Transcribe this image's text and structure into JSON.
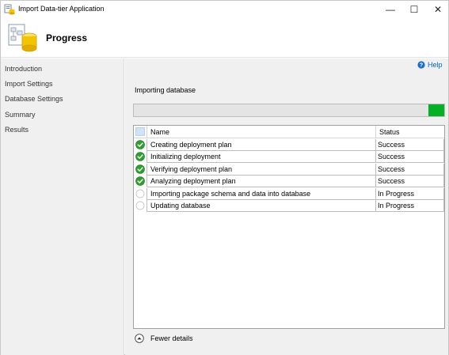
{
  "window": {
    "title": "Import Data-tier Application",
    "minimize_glyph": "—",
    "maximize_glyph": "☐",
    "close_glyph": "✕"
  },
  "header": {
    "title": "Progress",
    "icon": "database-wizard-icon"
  },
  "nav": {
    "items": [
      {
        "label": "Introduction"
      },
      {
        "label": "Import Settings"
      },
      {
        "label": "Database Settings"
      },
      {
        "label": "Summary"
      },
      {
        "label": "Results"
      }
    ]
  },
  "main": {
    "help_label": "Help",
    "operation_label": "Importing database",
    "progress_fraction": 0.05,
    "columns": {
      "name": "Name",
      "status": "Status"
    },
    "rows": [
      {
        "name": "Creating deployment plan",
        "status": "Success",
        "state": "success"
      },
      {
        "name": "Initializing deployment",
        "status": "Success",
        "state": "success"
      },
      {
        "name": "Verifying deployment plan",
        "status": "Success",
        "state": "success"
      },
      {
        "name": "Analyzing deployment plan",
        "status": "Success",
        "state": "success"
      },
      {
        "name": "Importing package schema and data into database",
        "status": "In Progress",
        "state": "in-progress"
      },
      {
        "name": "Updating database",
        "status": "In Progress",
        "state": "in-progress"
      }
    ],
    "details_toggle_label": "Fewer details"
  },
  "colors": {
    "progress_fill": "#06b025",
    "success_icon": "#2e9e2e",
    "link": "#0066cc"
  }
}
